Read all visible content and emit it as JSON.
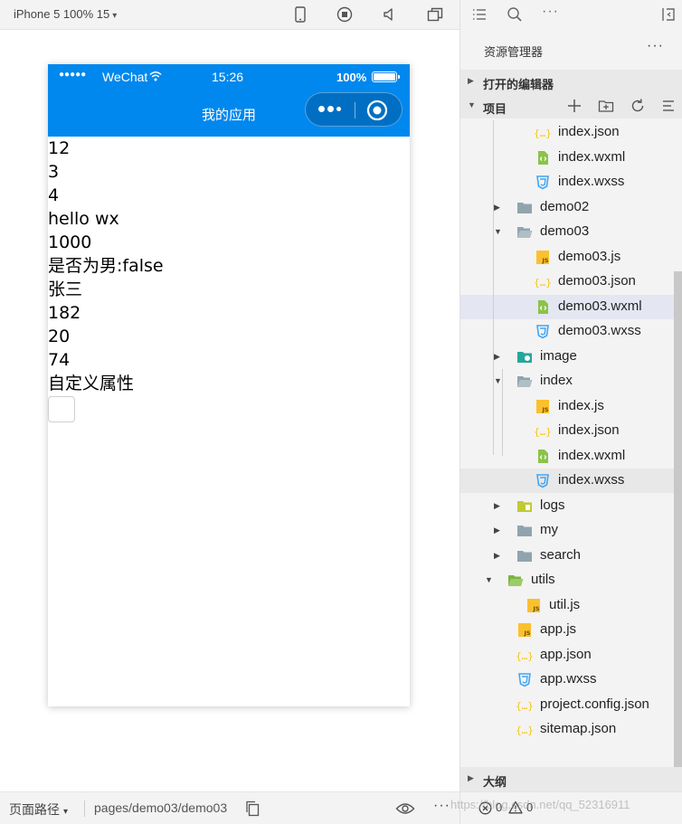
{
  "simulator": {
    "device": "iPhone 5 100% 15",
    "status_bar": {
      "signal": "●●●●●",
      "carrier": "WeChat",
      "time": "15:26",
      "battery": "100%"
    },
    "nav_title": "我的应用",
    "output_lines": [
      "12",
      "3",
      "4",
      "hello wx",
      "1000",
      "是否为男:false",
      "张三",
      "182",
      "20",
      "74",
      "自定义属性"
    ],
    "footer": {
      "path_label": "页面路径",
      "page_path": "pages/demo03/demo03"
    }
  },
  "explorer": {
    "title": "资源管理器",
    "sections": {
      "open_editors": "打开的编辑器",
      "project": "项目",
      "outline": "大纲"
    },
    "tree": [
      {
        "label": "index.json",
        "type": "json"
      },
      {
        "label": "index.wxml",
        "type": "wxml"
      },
      {
        "label": "index.wxss",
        "type": "wxss"
      },
      {
        "label": "demo02",
        "type": "folder",
        "state": "collapsed"
      },
      {
        "label": "demo03",
        "type": "folder",
        "state": "expanded"
      },
      {
        "label": "demo03.js",
        "type": "js"
      },
      {
        "label": "demo03.json",
        "type": "json"
      },
      {
        "label": "demo03.wxml",
        "type": "wxml",
        "selected": true
      },
      {
        "label": "demo03.wxss",
        "type": "wxss"
      },
      {
        "label": "image",
        "type": "image-folder",
        "state": "collapsed"
      },
      {
        "label": "index",
        "type": "folder",
        "state": "expanded"
      },
      {
        "label": "index.js",
        "type": "js"
      },
      {
        "label": "index.json",
        "type": "json"
      },
      {
        "label": "index.wxml",
        "type": "wxml"
      },
      {
        "label": "index.wxss",
        "type": "wxss",
        "hovered": true
      },
      {
        "label": "logs",
        "type": "logs-folder",
        "state": "collapsed"
      },
      {
        "label": "my",
        "type": "folder",
        "state": "collapsed"
      },
      {
        "label": "search",
        "type": "folder",
        "state": "collapsed"
      },
      {
        "label": "utils",
        "type": "utils-folder",
        "state": "expanded"
      },
      {
        "label": "util.js",
        "type": "js"
      },
      {
        "label": "app.js",
        "type": "js"
      },
      {
        "label": "app.json",
        "type": "json"
      },
      {
        "label": "app.wxss",
        "type": "wxss"
      },
      {
        "label": "project.config.json",
        "type": "json"
      },
      {
        "label": "sitemap.json",
        "type": "json"
      }
    ],
    "footer": {
      "errors": "0",
      "warnings": "0"
    },
    "watermark": "https://blog.csdn.net/qq_52316911"
  },
  "colors": {
    "wechat_nav": "#0088ee",
    "selection": "#e4e6f1",
    "json_icon": "#f5c518",
    "wxml_icon": "#8bc34a",
    "wxss_icon": "#42a5f5",
    "js_icon": "#fbc02d",
    "folder_icon": "#90a4ae"
  }
}
